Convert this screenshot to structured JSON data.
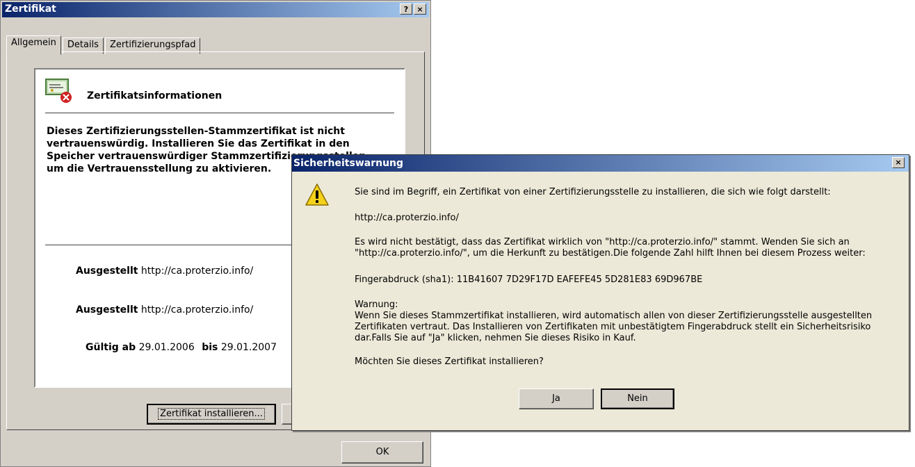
{
  "cert_window": {
    "title": "Zertifikat",
    "help_btn": "?",
    "close_btn": "×",
    "tabs": [
      {
        "label": "Allgemein"
      },
      {
        "label": "Details"
      },
      {
        "label": "Zertifizierungspfad"
      }
    ],
    "info_title": "Zertifikatsinformationen",
    "warning": "Dieses Zertifizierungsstellen-Stammzertifikat ist nicht vertrauenswürdig. Installieren Sie das Zertifikat in den Speicher vertrauenswürdiger Stammzertifizierungsstellen, um die Vertrauensstellung zu aktivieren.",
    "issued_to_label": "Ausgestellt",
    "issued_to_value": "http://ca.proterzio.info/",
    "issued_by_label": "Ausgestellt",
    "issued_by_value": "http://ca.proterzio.info/",
    "valid_from_label": "Gültig ab",
    "valid_from_value": "29.01.2006",
    "valid_to_label": "bis",
    "valid_to_value": "29.01.2007",
    "install_button": "Zertifikat installieren...",
    "ok_button": "OK"
  },
  "security_dialog": {
    "title": "Sicherheitswarnung",
    "close_btn": "×",
    "line1": "Sie sind im Begriff, ein Zertifikat von einer Zertifizierungsstelle zu installieren, die sich wie folgt darstellt:",
    "url": "http://ca.proterzio.info/",
    "line3": "Es wird nicht bestätigt, dass das Zertifikat wirklich von \"http://ca.proterzio.info/\" stammt. Wenden Sie sich an \"http://ca.proterzio.info/\", um die Herkunft zu bestätigen.Die folgende Zahl hilft Ihnen bei diesem Prozess weiter:",
    "fingerprint": "Fingerabdruck (sha1): 11B41607 7D29F17D EAFEFE45 5D281E83 69D967BE",
    "warning_label": "Warnung:",
    "warning_text": "Wenn Sie dieses Stammzertifikat installieren, wird automatisch allen von dieser Zertifizierungsstelle ausgestellten Zertifikaten vertraut. Das Installieren von Zertifikaten mit unbestätigtem Fingerabdruck stellt ein Sicherheitsrisiko dar.Falls Sie auf \"Ja\" klicken, nehmen Sie dieses Risiko in Kauf.",
    "question": "Möchten Sie dieses Zertifikat installieren?",
    "yes_button": "Ja",
    "no_button": "Nein"
  },
  "icons": {
    "certificate": "certificate-error-icon",
    "warning": "warning-triangle-icon"
  }
}
